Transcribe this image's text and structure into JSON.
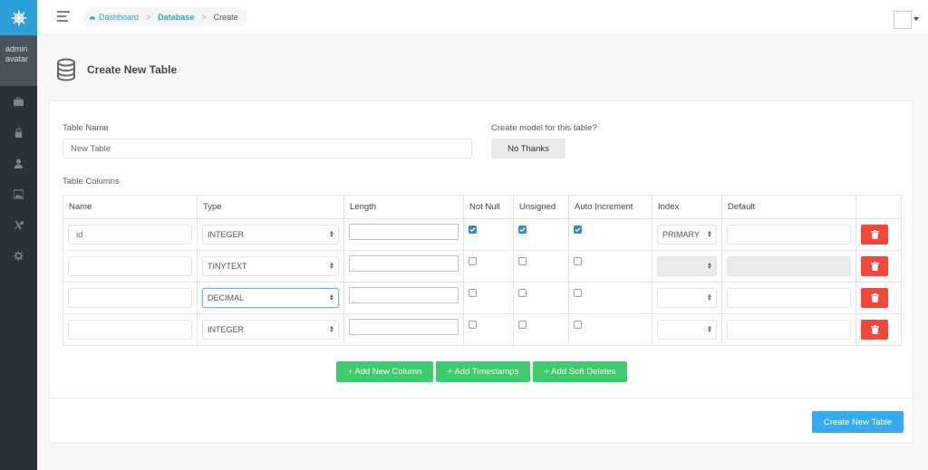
{
  "colors": {
    "accent": "#2c9fd8",
    "sidebar": "#2b3237",
    "success": "#3dcc6e",
    "danger": "#f5463a",
    "primary": "#36a9f0"
  },
  "sidebar": {
    "logo_icon": "ship-wheel-icon",
    "avatar_alt": "admin avatar",
    "items": [
      {
        "icon": "briefcase-icon"
      },
      {
        "icon": "lock-icon"
      },
      {
        "icon": "user-icon"
      },
      {
        "icon": "image-icon"
      },
      {
        "icon": "tools-icon"
      },
      {
        "icon": "gear-icon"
      }
    ]
  },
  "topbar": {
    "breadcrumb": [
      {
        "label": "Dashboard",
        "icon": "dashboard-icon"
      },
      {
        "label": "Database"
      },
      {
        "label": "Create"
      }
    ]
  },
  "page": {
    "title": "Create New Table",
    "icon": "database-icon"
  },
  "form": {
    "table_name_label": "Table Name",
    "table_name_value": "New Table",
    "model_label": "Create model for this table?",
    "model_button": "No Thanks",
    "columns_label": "Table Columns"
  },
  "table": {
    "headers": [
      "Name",
      "Type",
      "Length",
      "Not Null",
      "Unsigned",
      "Auto Increment",
      "Index",
      "Default",
      ""
    ],
    "rows": [
      {
        "name": "id",
        "type": "INTEGER",
        "length": "",
        "not_null": true,
        "unsigned": true,
        "auto_increment": true,
        "index": "PRIMARY",
        "default": ""
      },
      {
        "name": "",
        "type": "TINYTEXT",
        "length": "",
        "not_null": false,
        "unsigned": false,
        "auto_increment": false,
        "index": "",
        "default": ""
      },
      {
        "name": "",
        "type": "DECIMAL",
        "length": "",
        "not_null": false,
        "unsigned": false,
        "auto_increment": false,
        "index": "",
        "default": ""
      },
      {
        "name": "",
        "type": "INTEGER",
        "length": "",
        "not_null": false,
        "unsigned": false,
        "auto_increment": false,
        "index": "",
        "default": ""
      }
    ]
  },
  "actions": {
    "add_column": "+ Add New Column",
    "add_timestamps": "+ Add Timestamps",
    "add_soft_deletes": "+ Add Soft Deletes",
    "create_table": "Create New Table"
  }
}
